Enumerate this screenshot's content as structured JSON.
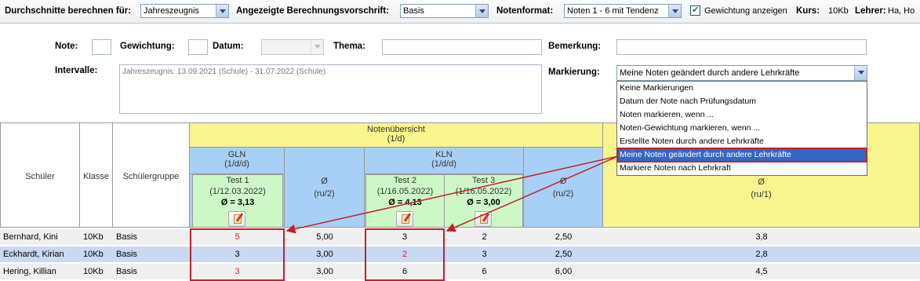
{
  "toolbar": {
    "averages_label": "Durchschnitte berechnen für:",
    "averages_value": "Jahreszeugnis",
    "rule_label": "Angezeigte Berechnungsvorschrift:",
    "rule_value": "Basis",
    "format_label": "Notenformat:",
    "format_value": "Noten 1 - 6 mit Tendenz",
    "weighting_label": "Gewichtung anzeigen",
    "weighting_checked": true,
    "course_label": "Kurs:",
    "course_value": "10Kb",
    "teacher_label": "Lehrer:",
    "teacher_value": "Ha, Ho"
  },
  "form": {
    "note_label": "Note:",
    "weight_label": "Gewichtung:",
    "date_label": "Datum:",
    "topic_label": "Thema:",
    "remark_label": "Bemerkung:",
    "intervals_label": "Intervalle:",
    "intervals_text": "Jahreszeugnis: 13.09.2021 (Schule) - 31.07.2022 (Schule)",
    "marking_label": "Markierung:",
    "marking_value": "Meine Noten geändert durch andere Lehrkräfte"
  },
  "marking_options": [
    "Keine Markierungen",
    "Datum der Note nach Prüfungsdatum",
    "Noten markieren, wenn ...",
    "Noten-Gewichtung markieren, wenn ...",
    "Erstellte Noten durch andere Lehrkräfte",
    "Meine Noten geändert durch andere Lehrkräfte",
    "Markiere Noten nach Lehrkraft"
  ],
  "grid": {
    "col_student": "Schüler",
    "col_class": "Klasse",
    "col_group": "Schülergruppe",
    "overview_title": "Notenübersicht",
    "overview_sub": "(1/d)",
    "gln_title": "GLN",
    "gln_sub": "(1/d/d)",
    "kln_title": "KLN",
    "kln_sub": "(1/d/d)",
    "avg_symbol": "Ø",
    "avg_sub_ru2": "(ru/2)",
    "avg_sub_ru1": "(ru/1)",
    "tests": [
      {
        "name": "Test 1",
        "meta": "(1/12.03.2022)",
        "avg": "Ø = 3,13"
      },
      {
        "name": "Test 2",
        "meta": "(1/16.05.2022)",
        "avg": "Ø = 4,13"
      },
      {
        "name": "Test 3",
        "meta": "(1/16.05.2022)",
        "avg": "Ø = 3,00"
      }
    ],
    "rows": [
      {
        "name": "Bernhard, Kini",
        "class": "10Kb",
        "group": "Basis",
        "t1": "5",
        "gln_avg": "5,00",
        "t2": "3",
        "t3": "2",
        "kln_avg": "2,50",
        "total": "3,8"
      },
      {
        "name": "Eckhardt, Kirian",
        "class": "10Kb",
        "group": "Basis",
        "t1": "3",
        "gln_avg": "3,00",
        "t2": "2",
        "t3": "3",
        "kln_avg": "2,50",
        "total": "2,8"
      },
      {
        "name": "Hering, Killian",
        "class": "10Kb",
        "group": "Basis",
        "t1": "3",
        "gln_avg": "3,00",
        "t2": "6",
        "t3": "6",
        "kln_avg": "6,00",
        "total": "4,5"
      }
    ],
    "changed_marks": [
      {
        "row": 0,
        "col": "t1"
      },
      {
        "row": 1,
        "col": "t2"
      },
      {
        "row": 2,
        "col": "t1"
      }
    ]
  },
  "colors": {
    "highlight": "#c0232a",
    "overview": "#f8f58e",
    "gln_kln": "#a8cff5",
    "test": "#cdf7c6",
    "row_alt": "#c9d9f1"
  }
}
